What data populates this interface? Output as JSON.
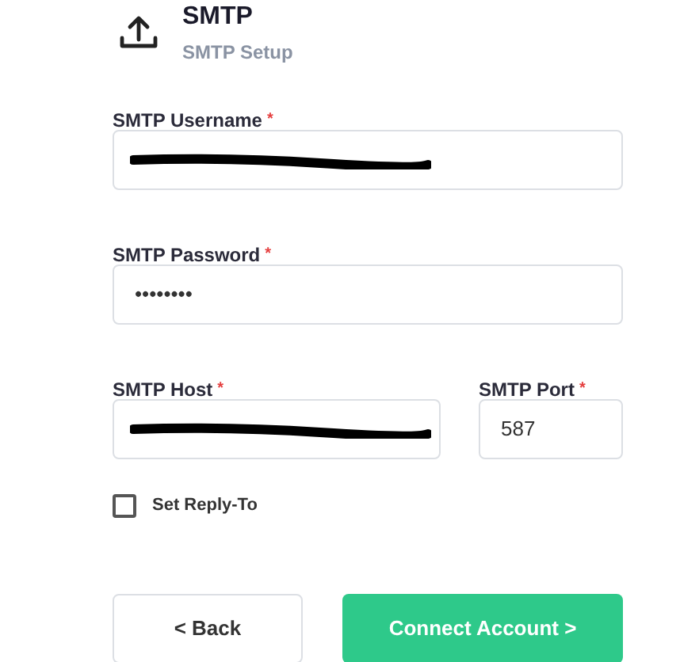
{
  "header": {
    "title": "SMTP",
    "subtitle": "SMTP Setup"
  },
  "fields": [
    {
      "label": "SMTP Username",
      "required_mark": "*",
      "redacted": true
    },
    {
      "label": "SMTP Password",
      "required_mark": "*",
      "value": "••••••••"
    }
  ],
  "row_fields": [
    {
      "label": "SMTP Host",
      "required_mark": "*",
      "redacted": true
    },
    {
      "label": "SMTP Port",
      "required_mark": "*",
      "value": "587"
    }
  ],
  "checkbox": {
    "label": "Set Reply-To",
    "checked": false
  },
  "buttons": [
    {
      "label": "< Back",
      "kind": "secondary"
    },
    {
      "label": "Connect Account >",
      "kind": "primary"
    }
  ]
}
